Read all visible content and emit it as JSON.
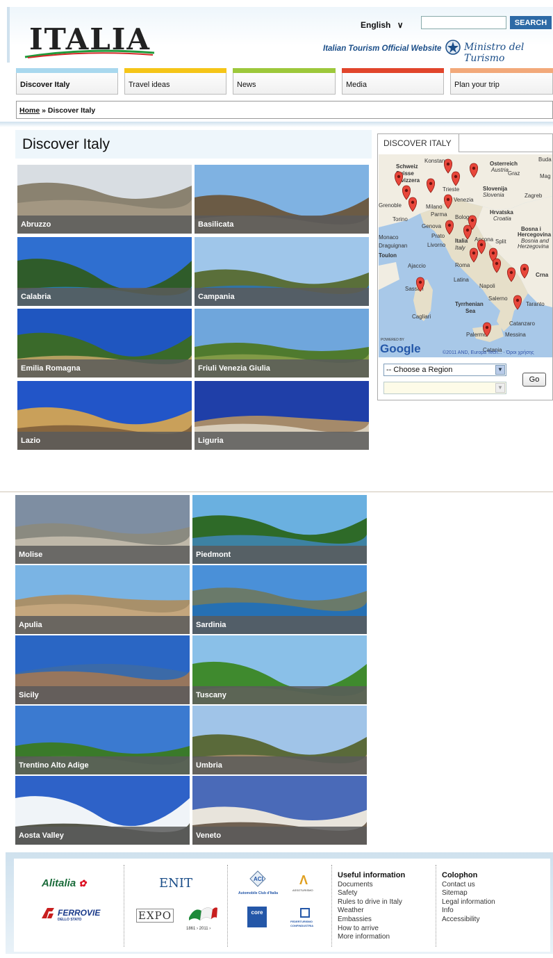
{
  "header": {
    "logo_text": "ITALIA",
    "language": "English",
    "search_label": "SEARCH",
    "search_placeholder": "",
    "tagline": "Italian Tourism Official Website",
    "ministry": "Ministro del Turismo"
  },
  "nav": [
    {
      "label": "Discover Italy",
      "color": "#a9d8ee"
    },
    {
      "label": "Travel ideas",
      "color": "#f5c518"
    },
    {
      "label": "News",
      "color": "#9dc83b"
    },
    {
      "label": "Media",
      "color": "#e1452b"
    },
    {
      "label": "Plan your trip",
      "color": "#f2a97a"
    }
  ],
  "breadcrumb": {
    "home": "Home",
    "sep": "»",
    "current": "Discover Italy"
  },
  "main": {
    "title": "Discover Italy"
  },
  "regions": [
    "Abruzzo",
    "Basilicata",
    "Calabria",
    "Campania",
    "Emilia Romagna",
    "Friuli Venezia Giulia",
    "Lazio",
    "Liguria",
    "Molise",
    "Piedmont",
    "Apulia",
    "Sardinia",
    "Sicily",
    "Tuscany",
    "Trentino Alto Adige",
    "Umbria",
    "Aosta Valley",
    "Veneto"
  ],
  "sidebar": {
    "tab": "DISCOVER ITALY",
    "map_labels": [
      "Schweiz",
      "Suisse",
      "Svizzera",
      "Konstanz",
      "Osterreich",
      "Austria",
      "Graz",
      "Slovenija",
      "Slovenia",
      "Zagreb",
      "Hrvatska",
      "Croatia",
      "Bosna i",
      "Hercegovina",
      "Bosnia and",
      "Herzegovina",
      "Grenoble",
      "Torino",
      "Milano",
      "Trieste",
      "Venezia",
      "Parma",
      "Genova",
      "Bologna",
      "Monaco",
      "Draguignan",
      "Prato",
      "Livorno",
      "Italia",
      "Italy",
      "Ancona",
      "Split",
      "Toulon",
      "Ajaccio",
      "Roma",
      "Latina",
      "Napoli",
      "Salerno",
      "Sassari",
      "Tyrrhenian",
      "Sea",
      "Cagliari",
      "Taranto",
      "Catanzaro",
      "Palermo",
      "Messina",
      "Catania",
      "Crna",
      "Buda",
      "Mag"
    ],
    "map_credit": "POWERED BY",
    "map_brand": "Google",
    "map_copyright": "©2011 AND, Europa Tech... - Όροι χρήσης",
    "region_select": "-- Choose a Region",
    "go_label": "Go"
  },
  "footer": {
    "logos": [
      "Alitalia",
      "FERROVIE",
      "DELLO STATO",
      "ENIT",
      "EXPO",
      "1861 › 2011 ›",
      "ACI",
      "Automobile Club d'Italia",
      "ASSOTURISMO",
      "core",
      "FEDERTURISMO",
      "CONFINDUSTRIA"
    ],
    "useful": {
      "title": "Useful information",
      "links": [
        "Documents",
        "Safety",
        "Rules to drive in Italy",
        "Weather",
        "Embassies",
        "How to arrive",
        "More information"
      ]
    },
    "colophon": {
      "title": "Colophon",
      "links": [
        "Contact us",
        "Sitemap",
        "Legal information",
        "Info",
        "Accessibility"
      ]
    }
  }
}
